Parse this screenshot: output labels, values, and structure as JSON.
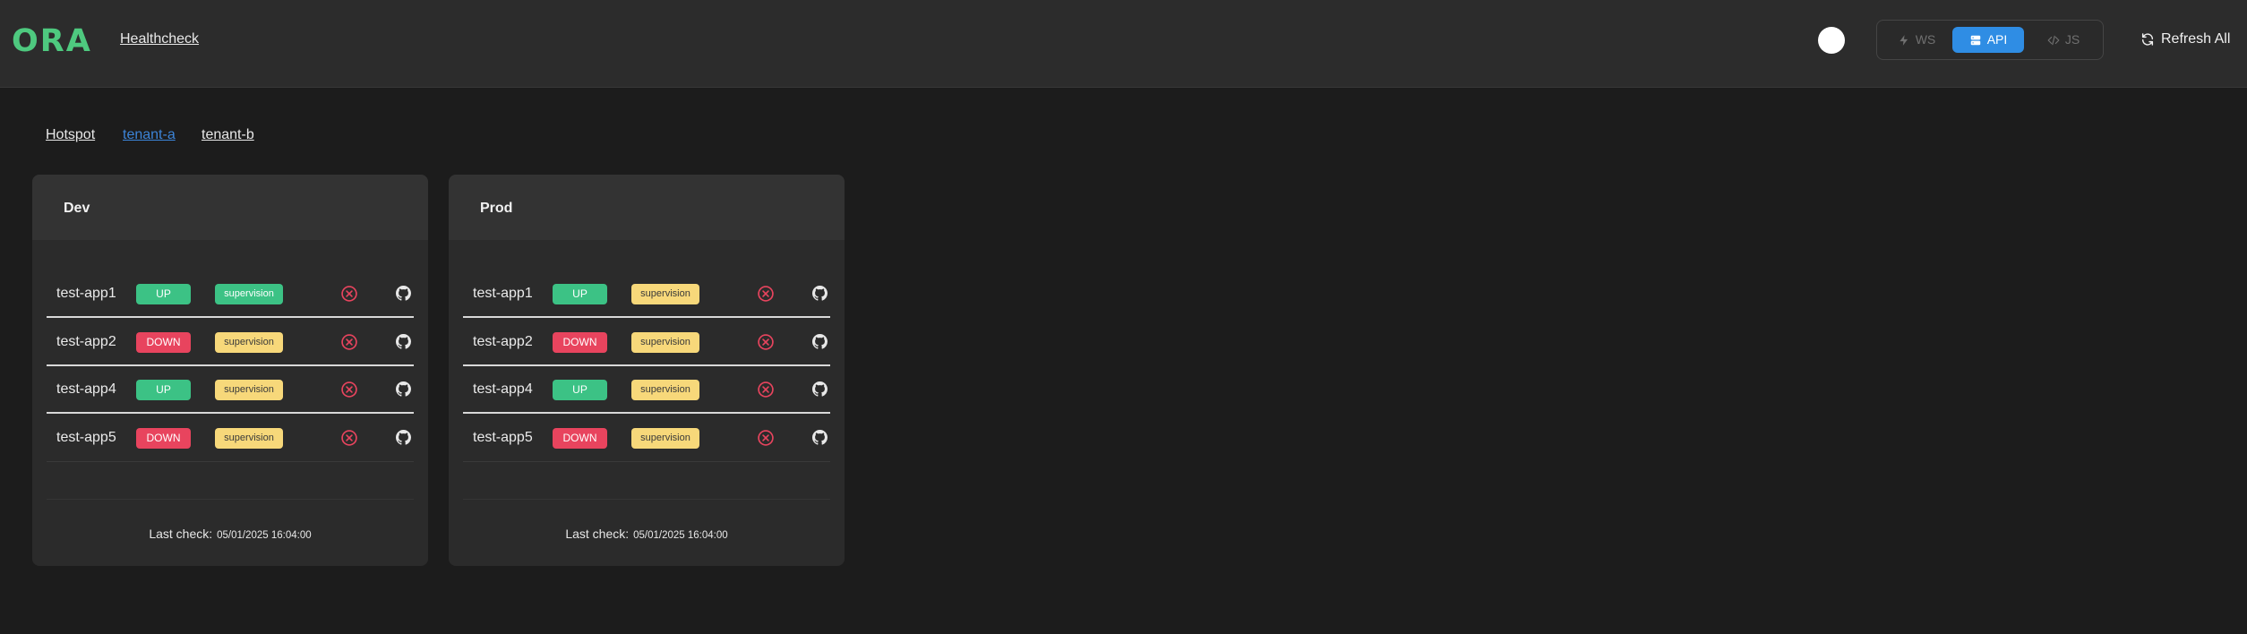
{
  "header": {
    "logo": "ORA",
    "nav_link": "Healthcheck",
    "modes": {
      "ws": "WS",
      "api": "API",
      "js": "JS",
      "active": "API"
    },
    "refresh_label": "Refresh All"
  },
  "tabs": [
    {
      "label": "Hotspot",
      "active": false
    },
    {
      "label": "tenant-a",
      "active": true
    },
    {
      "label": "tenant-b",
      "active": false
    }
  ],
  "cards": [
    {
      "title": "Dev",
      "apps": [
        {
          "name": "test-app1",
          "status": "UP",
          "tag": "supervision"
        },
        {
          "name": "test-app2",
          "status": "DOWN",
          "tag": "supervision"
        },
        {
          "name": "test-app4",
          "status": "UP",
          "tag": "supervision"
        },
        {
          "name": "test-app5",
          "status": "DOWN",
          "tag": "supervision"
        }
      ],
      "last_check_label": "Last check:",
      "last_check_value": "05/01/2025 16:04:00"
    },
    {
      "title": "Prod",
      "apps": [
        {
          "name": "test-app1",
          "status": "UP",
          "tag": "supervision"
        },
        {
          "name": "test-app2",
          "status": "DOWN",
          "tag": "supervision"
        },
        {
          "name": "test-app4",
          "status": "UP",
          "tag": "supervision"
        },
        {
          "name": "test-app5",
          "status": "DOWN",
          "tag": "supervision"
        }
      ],
      "last_check_label": "Last check:",
      "last_check_value": "05/01/2025 16:04:00"
    }
  ],
  "colors": {
    "brand": "#4ec97f",
    "status_up": "#3cc285",
    "status_down": "#e8445e",
    "tag_yellow": "#f7d87a",
    "api_active": "#2f8de4",
    "active_tab": "#3c84d8",
    "remove_icon": "#e8445e"
  },
  "icons": {
    "ws": "bolt-icon",
    "api": "server-icon",
    "js": "code-icon",
    "refresh": "refresh-icon",
    "remove": "x-circle-icon",
    "repo": "github-icon"
  }
}
